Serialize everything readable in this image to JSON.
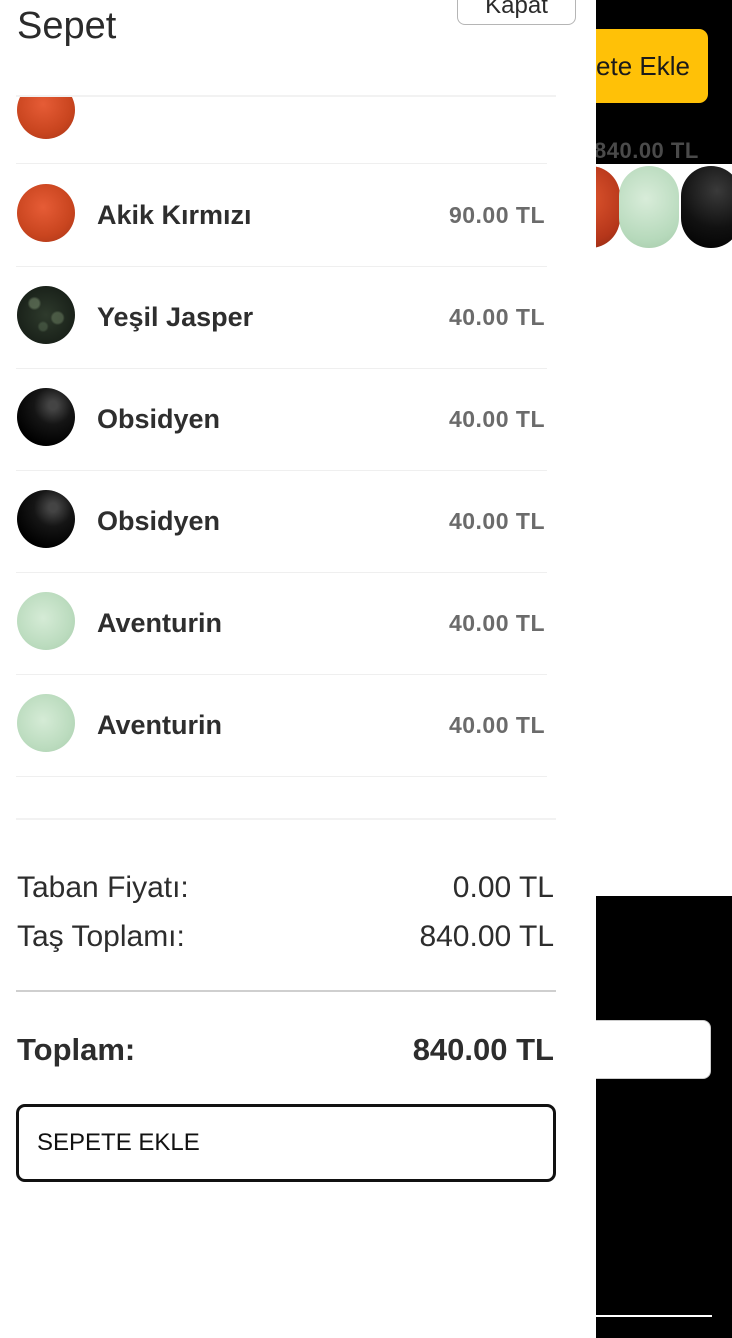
{
  "background": {
    "add_button_label": "Sepete Ekle",
    "price_label": "840.00 TL",
    "accent_color": "#FFC107"
  },
  "drawer": {
    "title": "Sepet",
    "close_label": "Kapat",
    "items": [
      {
        "name": "Akik Kırmızı",
        "price": "90.00 TL",
        "stone": "red-agate"
      },
      {
        "name": "Yeşil Jasper",
        "price": "40.00 TL",
        "stone": "green-jasper"
      },
      {
        "name": "Obsidyen",
        "price": "40.00 TL",
        "stone": "obsidian"
      },
      {
        "name": "Obsidyen",
        "price": "40.00 TL",
        "stone": "obsidian"
      },
      {
        "name": "Aventurin",
        "price": "40.00 TL",
        "stone": "aventurine"
      },
      {
        "name": "Aventurin",
        "price": "40.00 TL",
        "stone": "aventurine"
      }
    ],
    "summary": {
      "base_price_label": "Taban Fiyatı:",
      "base_price_value": "0.00 TL",
      "stone_total_label": "Taş Toplamı:",
      "stone_total_value": "840.00 TL",
      "total_label": "Toplam:",
      "total_value": "840.00 TL"
    },
    "add_to_cart_label": "SEPETE EKLE"
  }
}
